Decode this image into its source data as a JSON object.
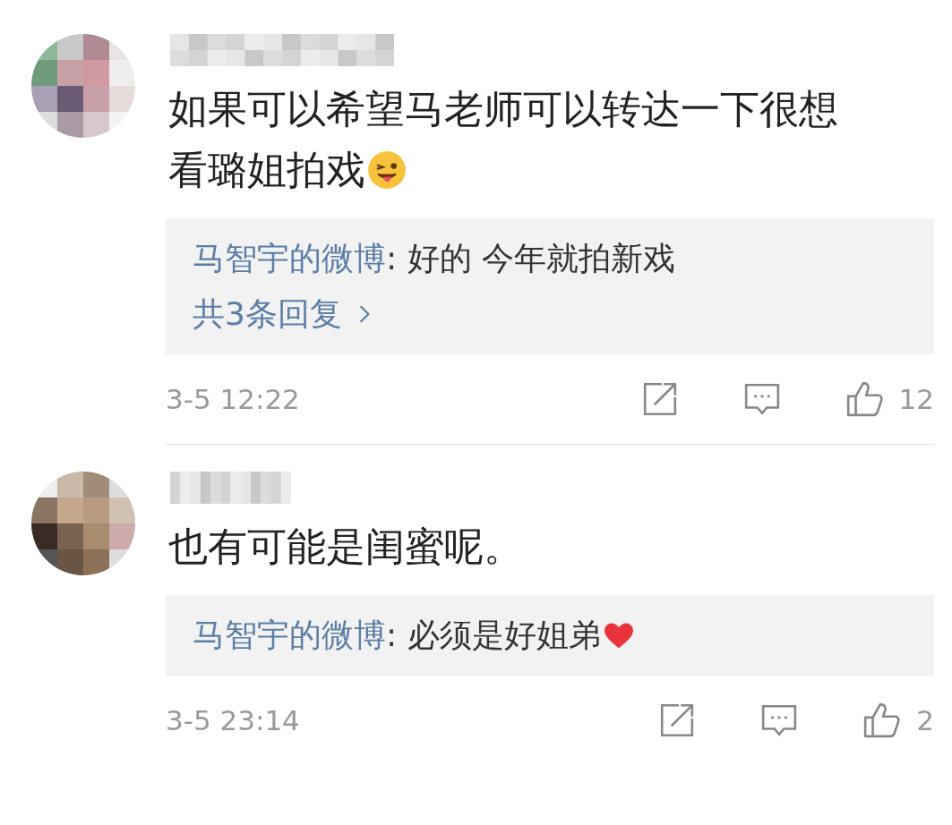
{
  "comments": [
    {
      "avatar": {
        "kind": "picture"
      },
      "lines": [
        "如果可以希望马老师可以转达一下很想",
        "看璐姐拍戏"
      ],
      "emoji": {
        "kind": "tongue"
      },
      "reply": {
        "author": "马智宇的微博",
        "text": ": 好的 今年就拍新戏",
        "more": "共3条回复"
      },
      "time": "3-5 12:22",
      "likes": "12"
    },
    {
      "avatar": {
        "kind": "picture"
      },
      "lines": [
        "也有可能是闺蜜呢。"
      ],
      "reply": {
        "author": "马智宇的微博",
        "text": ": 必须是好姐弟",
        "emoji": {
          "kind": "heart"
        }
      },
      "time": "3-5 23:14",
      "likes": "2"
    }
  ]
}
